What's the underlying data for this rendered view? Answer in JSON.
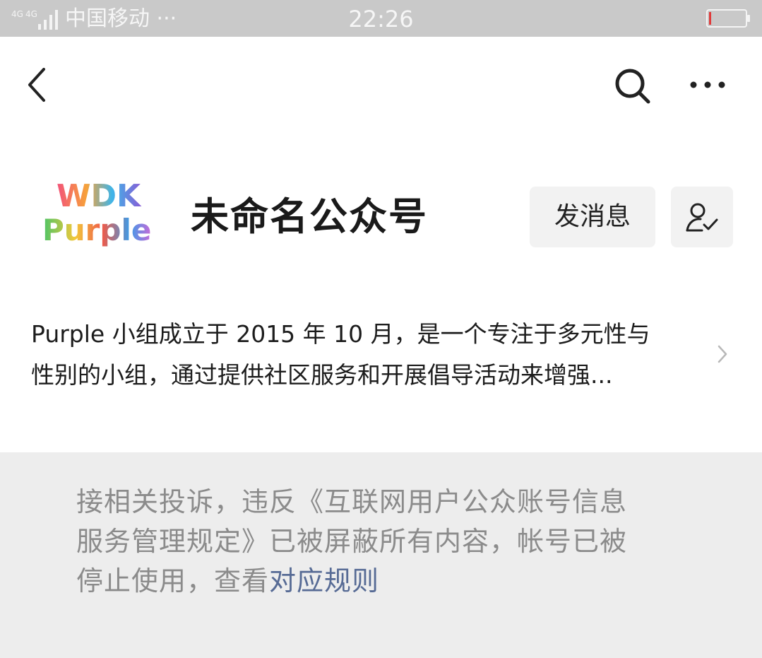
{
  "status_bar": {
    "network": "4G 4G",
    "carrier": "中国移动 ···",
    "time": "22:26",
    "battery_level": 0.05,
    "battery_color": "#e03a3a"
  },
  "nav_bar": {
    "back_icon": "chevron-left-icon",
    "search_icon": "search-icon",
    "more_icon": "more-horizontal-icon"
  },
  "profile": {
    "logo_text": [
      "WDK",
      "Purple"
    ],
    "account_name": "未命名公众号",
    "message_button": "发消息",
    "follow_icon": "user-follow-check-icon",
    "intro_lines": [
      "Purple 小组成立于 2015 年 10 月，是一个专注于多元性与",
      "性别的小组，通过提供社区服务和开展倡导活动来增强..."
    ]
  },
  "notice": {
    "line1": "接相关投诉，违反《互联网用户公众账号信息",
    "line2": "服务管理规定》已被屏蔽所有内容，帐号已被",
    "line3_prefix": "停止使用，查看",
    "link": "对应规则",
    "link_color": "#576b95"
  }
}
